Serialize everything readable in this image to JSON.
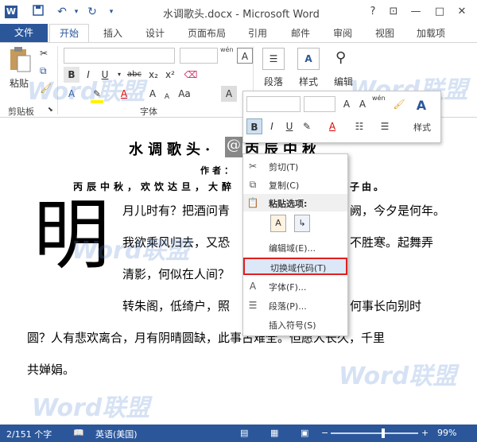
{
  "window": {
    "title": "水调歌头.docx - Microsoft Word",
    "app_icon": "W",
    "help": "?"
  },
  "tabs": {
    "file": "文件",
    "items": [
      "开始",
      "插入",
      "设计",
      "页面布局",
      "引用",
      "邮件",
      "审阅",
      "视图",
      "加载项"
    ]
  },
  "ribbon": {
    "paste_label": "粘贴",
    "clipboard_group": "剪贴板",
    "font_group": "字体",
    "paragraph_label": "段落",
    "styles_label": "样式",
    "editing_label": "编辑",
    "font_size_small": "A",
    "wen": "wén",
    "abc": "abc"
  },
  "mini_toolbar": {
    "styles_label": "样式"
  },
  "document": {
    "title": "水调歌头·",
    "title_rest": "丙辰中秋",
    "field_char": "@",
    "author_line": "作者：",
    "preface": "丙辰中秋，欢饮达旦，大醉",
    "preface_end": "子由。",
    "drop_cap": "明",
    "lines": [
      "月儿时有？把酒问青",
      "阙，今夕是何年。",
      "我欲乘风归去，又恐",
      "不胜寒。起舞弄",
      "清影，何似在人间？",
      "转朱阁，低绮户，照",
      "何事长向别时",
      "圆？人有悲欢离合，月有阴晴圆缺，此事古难全。但愿人长久，千里",
      "共婵娟。"
    ]
  },
  "context_menu": {
    "items": [
      {
        "icon": "scissors-icon",
        "label": "剪切(T)"
      },
      {
        "icon": "copy-icon",
        "label": "复制(C)"
      },
      {
        "icon": "paste-icon",
        "label": "粘贴选项:"
      },
      {
        "icon": "",
        "label": "编辑域(E)..."
      },
      {
        "icon": "",
        "label": "切换域代码(T)"
      },
      {
        "icon": "font-icon",
        "label": "字体(F)..."
      },
      {
        "icon": "paragraph-icon",
        "label": "段落(P)..."
      },
      {
        "icon": "",
        "label": "插入符号(S)"
      }
    ]
  },
  "status": {
    "pages": "2/151 个字",
    "language": "英语(美国)",
    "zoom": "99%",
    "zoom_level": 0.6
  },
  "watermark": "Word联盟",
  "colors": {
    "accent": "#2b579a",
    "highlight": "#fff200",
    "font_red": "#e00000",
    "selected_border": "#e02020"
  }
}
